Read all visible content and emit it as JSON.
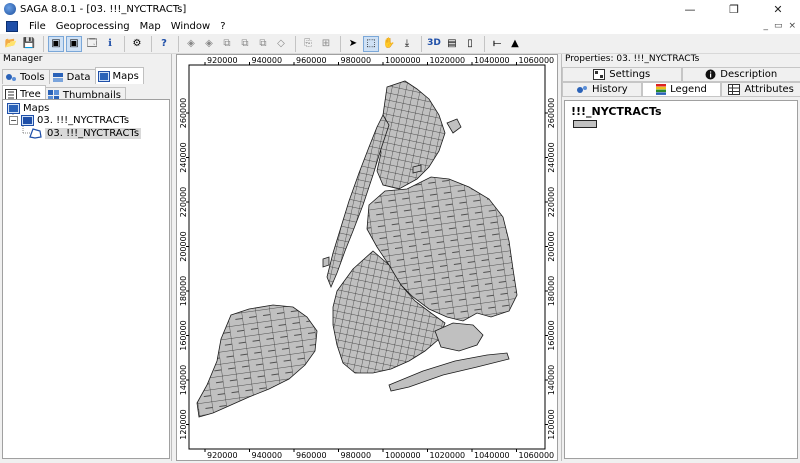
{
  "window": {
    "title": "SAGA 8.0.1 - [03. !!!_NYCTRACTs]",
    "controls": {
      "minimize": "—",
      "restore": "❐",
      "close": "✕"
    }
  },
  "menu": {
    "items": [
      "File",
      "Geoprocessing",
      "Map",
      "Window",
      "?"
    ],
    "mdi_controls": {
      "minimize": "_",
      "restore": "▭",
      "close": "×"
    }
  },
  "toolbar": {
    "buttons": [
      {
        "name": "open-icon",
        "glyph": "📂"
      },
      {
        "name": "save-icon",
        "glyph": "💾"
      },
      {
        "name": "sep"
      },
      {
        "name": "manager-toggle-icon",
        "glyph": "▣",
        "pressed": true
      },
      {
        "name": "properties-toggle-icon",
        "glyph": "▣",
        "pressed": true
      },
      {
        "name": "data-source-icon",
        "glyph": "🗔"
      },
      {
        "name": "info-icon",
        "glyph": "ℹ"
      },
      {
        "name": "sep"
      },
      {
        "name": "tools-icon",
        "glyph": "⚙"
      },
      {
        "name": "sep"
      },
      {
        "name": "help-icon",
        "glyph": "?"
      },
      {
        "name": "sep"
      },
      {
        "name": "zoom-back-icon",
        "glyph": "◈"
      },
      {
        "name": "zoom-forward-icon",
        "glyph": "◈"
      },
      {
        "name": "zoom-full-icon",
        "glyph": "⧉"
      },
      {
        "name": "zoom-layer-icon",
        "glyph": "⧉"
      },
      {
        "name": "zoom-selection-icon",
        "glyph": "⧉"
      },
      {
        "name": "zoom-extent-icon",
        "glyph": "◇"
      },
      {
        "name": "sep"
      },
      {
        "name": "copy-map-icon",
        "glyph": "⎘"
      },
      {
        "name": "sync-maps-icon",
        "glyph": "⊞"
      },
      {
        "name": "sep"
      },
      {
        "name": "select-arrow-icon",
        "glyph": "➤"
      },
      {
        "name": "zoom-tool-icon",
        "glyph": "⬚",
        "pressed": true
      },
      {
        "name": "pan-tool-icon",
        "glyph": "✋"
      },
      {
        "name": "pan-down-icon",
        "glyph": "⤓"
      },
      {
        "name": "sep"
      },
      {
        "name": "3d-view-icon",
        "glyph": "3D"
      },
      {
        "name": "layout-icon",
        "glyph": "▤"
      },
      {
        "name": "print-icon",
        "glyph": "▯"
      },
      {
        "name": "sep"
      },
      {
        "name": "scale-bar-icon",
        "glyph": "⟝"
      },
      {
        "name": "north-arrow-icon",
        "glyph": "▲"
      }
    ]
  },
  "manager": {
    "title": "Manager",
    "tabs": [
      {
        "label": "Tools",
        "icon": "tools-tab-icon",
        "active": false
      },
      {
        "label": "Data",
        "icon": "data-tab-icon",
        "active": false
      },
      {
        "label": "Maps",
        "icon": "maps-tab-icon",
        "active": true
      }
    ],
    "subtabs": [
      {
        "label": "Tree",
        "icon": "tree-tab-icon",
        "active": true
      },
      {
        "label": "Thumbnails",
        "icon": "thumbnails-tab-icon",
        "active": false
      }
    ],
    "tree": {
      "root": "Maps",
      "map": "03. !!!_NYCTRACTs",
      "layer": "03. !!!_NYCTRACTs"
    }
  },
  "map": {
    "x_ticks": [
      "920000",
      "940000",
      "960000",
      "980000",
      "1000000",
      "1020000",
      "1040000",
      "1060000"
    ],
    "y_ticks": [
      "260000",
      "240000",
      "220000",
      "200000",
      "180000",
      "160000",
      "140000",
      "120000"
    ],
    "fill_color": "#c0c0c0",
    "line_color": "#1a1a1a"
  },
  "properties": {
    "title": "Properties: 03. !!!_NYCTRACTs",
    "tabs_row1": [
      {
        "label": "Settings",
        "icon": "settings-tab-icon",
        "active": false
      },
      {
        "label": "Description",
        "icon": "description-tab-icon",
        "active": false
      }
    ],
    "tabs_row2": [
      {
        "label": "History",
        "icon": "history-tab-icon",
        "active": false
      },
      {
        "label": "Legend",
        "icon": "legend-tab-icon",
        "active": true
      },
      {
        "label": "Attributes",
        "icon": "attributes-tab-icon",
        "active": false
      }
    ],
    "legend": {
      "title": "!!!_NYCTRACTs",
      "swatch_color": "#c0c0c0"
    }
  }
}
